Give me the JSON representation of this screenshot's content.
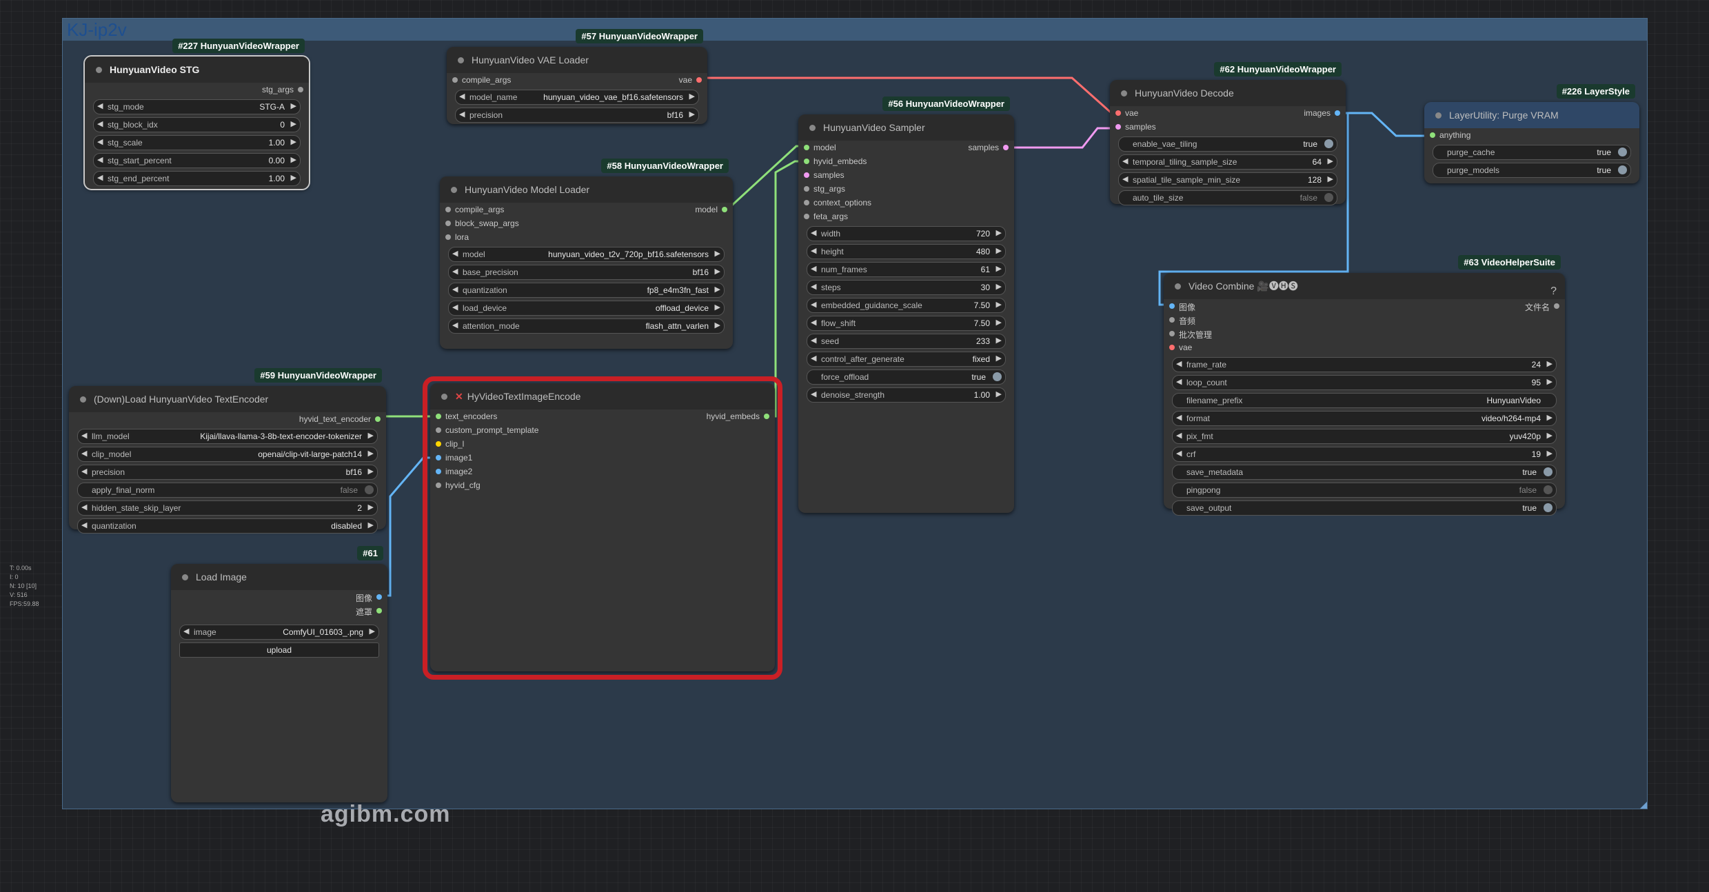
{
  "group_title": "KJ-ip2v",
  "colors": {
    "model": "#8fe07a",
    "vae": "#ff6e6e",
    "samples": "#f09af0",
    "images": "#64b5f6",
    "clip": "#ffd500",
    "neutral": "#9e9e9e",
    "highlight": "#c91f25"
  },
  "stats": [
    "T: 0.00s",
    "I: 0",
    "N: 10 [10]",
    "V: 516",
    "FPS:59.88"
  ],
  "watermark": "agibm.com",
  "stg": {
    "badge": "#227 HunyuanVideoWrapper",
    "title": "HunyuanVideo STG",
    "output": "stg_args",
    "widgets": [
      {
        "label": "stg_mode",
        "value": "STG-A"
      },
      {
        "label": "stg_block_idx",
        "value": "0"
      },
      {
        "label": "stg_scale",
        "value": "1.00"
      },
      {
        "label": "stg_start_percent",
        "value": "0.00"
      },
      {
        "label": "stg_end_percent",
        "value": "1.00"
      }
    ]
  },
  "vae_loader": {
    "badge": "#57 HunyuanVideoWrapper",
    "title": "HunyuanVideo VAE Loader",
    "input": "compile_args",
    "output": "vae",
    "widgets": [
      {
        "label": "model_name",
        "value": "hunyuan_video_vae_bf16.safetensors"
      },
      {
        "label": "precision",
        "value": "bf16"
      }
    ]
  },
  "model_loader": {
    "badge": "#58 HunyuanVideoWrapper",
    "title": "HunyuanVideo Model Loader",
    "inputs": [
      "compile_args",
      "block_swap_args",
      "lora"
    ],
    "output": "model",
    "widgets": [
      {
        "label": "model",
        "value": "hunyuan_video_t2v_720p_bf16.safetensors"
      },
      {
        "label": "base_precision",
        "value": "bf16"
      },
      {
        "label": "quantization",
        "value": "fp8_e4m3fn_fast"
      },
      {
        "label": "load_device",
        "value": "offload_device"
      },
      {
        "label": "attention_mode",
        "value": "flash_attn_varlen"
      }
    ]
  },
  "sampler": {
    "badge": "#56 HunyuanVideoWrapper",
    "title": "HunyuanVideo Sampler",
    "inputs": [
      "model",
      "hyvid_embeds",
      "samples",
      "stg_args",
      "context_options",
      "feta_args"
    ],
    "output": "samples",
    "widgets": [
      {
        "label": "width",
        "value": "720"
      },
      {
        "label": "height",
        "value": "480"
      },
      {
        "label": "num_frames",
        "value": "61"
      },
      {
        "label": "steps",
        "value": "30"
      },
      {
        "label": "embedded_guidance_scale",
        "value": "7.50"
      },
      {
        "label": "flow_shift",
        "value": "7.50"
      },
      {
        "label": "seed",
        "value": "233"
      },
      {
        "label": "control_after_generate",
        "value": "fixed"
      }
    ],
    "force_offload": {
      "label": "force_offload",
      "value": "true"
    },
    "denoise": {
      "label": "denoise_strength",
      "value": "1.00"
    }
  },
  "decode": {
    "badge": "#62 HunyuanVideoWrapper",
    "title": "HunyuanVideo Decode",
    "inputs": [
      "vae",
      "samples"
    ],
    "output": "images",
    "enable_vae_tiling": {
      "label": "enable_vae_tiling",
      "value": "true"
    },
    "widgets": [
      {
        "label": "temporal_tiling_sample_size",
        "value": "64"
      },
      {
        "label": "spatial_tile_sample_min_size",
        "value": "128"
      }
    ],
    "auto_tile_size": {
      "label": "auto_tile_size",
      "value": "false"
    }
  },
  "purge": {
    "badge": "#226 LayerStyle",
    "title": "LayerUtility: Purge VRAM",
    "input": "anything",
    "toggles": [
      {
        "label": "purge_cache",
        "value": "true"
      },
      {
        "label": "purge_models",
        "value": "true"
      }
    ]
  },
  "text_encoder": {
    "badge": "#59 HunyuanVideoWrapper",
    "title": "(Down)Load HunyuanVideo TextEncoder",
    "output": "hyvid_text_encoder",
    "widgets": [
      {
        "label": "llm_model",
        "value": "Kijai/llava-llama-3-8b-text-encoder-tokenizer"
      },
      {
        "label": "clip_model",
        "value": "openai/clip-vit-large-patch14"
      },
      {
        "label": "precision",
        "value": "bf16"
      }
    ],
    "apply_final_norm": {
      "label": "apply_final_norm",
      "value": "false"
    },
    "widgets2": [
      {
        "label": "hidden_state_skip_layer",
        "value": "2"
      },
      {
        "label": "quantization",
        "value": "disabled"
      }
    ]
  },
  "encode": {
    "title": "HyVideoTextImageEncode",
    "inputs": [
      "text_encoders",
      "custom_prompt_template",
      "clip_l",
      "image1",
      "image2",
      "hyvid_cfg"
    ],
    "output": "hyvid_embeds"
  },
  "load_image": {
    "badge": "#61",
    "title": "Load Image",
    "outputs": [
      "图像",
      "遮罩"
    ],
    "image": {
      "label": "image",
      "value": "ComfyUI_01603_.png"
    },
    "upload": "upload"
  },
  "video_combine": {
    "badge": "#63 VideoHelperSuite",
    "title": "Video Combine 🎥🅥🅗🅢",
    "help": "?",
    "inputs": [
      "图像",
      "音频",
      "批次管理",
      "vae"
    ],
    "output": "文件名",
    "widgets": [
      {
        "label": "frame_rate",
        "value": "24",
        "arrows": true
      },
      {
        "label": "loop_count",
        "value": "95",
        "arrows": true
      },
      {
        "label": "filename_prefix",
        "value": "HunyuanVideo",
        "arrows": false
      },
      {
        "label": "format",
        "value": "video/h264-mp4",
        "arrows": true
      },
      {
        "label": "pix_fmt",
        "value": "yuv420p",
        "arrows": true
      },
      {
        "label": "crf",
        "value": "19",
        "arrows": true
      }
    ],
    "toggles": [
      {
        "label": "save_metadata",
        "value": "true",
        "on": true
      },
      {
        "label": "pingpong",
        "value": "false",
        "on": false
      },
      {
        "label": "save_output",
        "value": "true",
        "on": true
      }
    ]
  }
}
